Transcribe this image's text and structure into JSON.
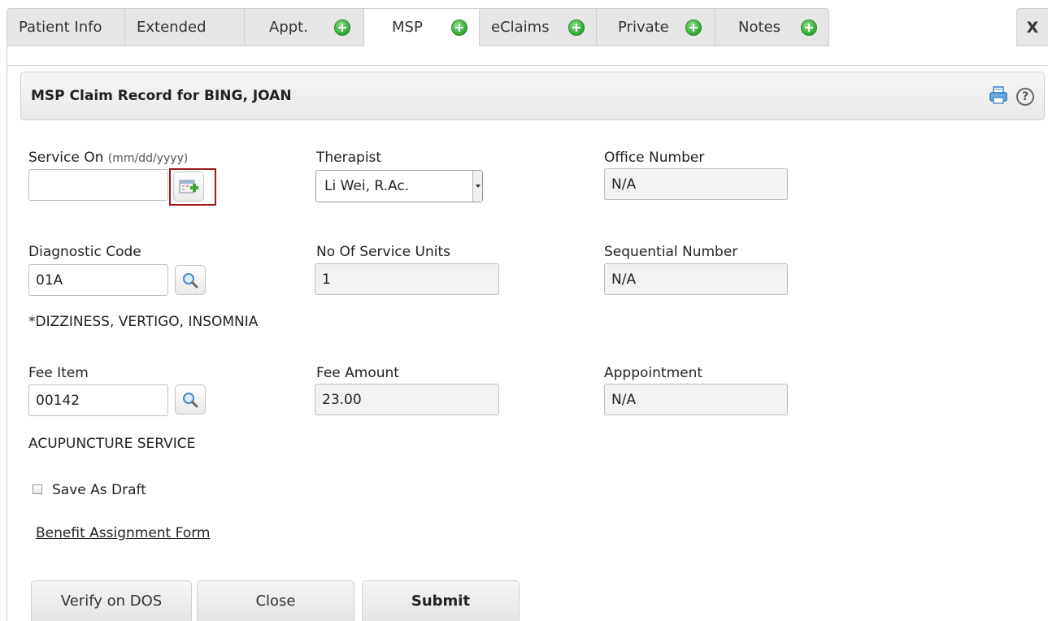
{
  "tabs": [
    {
      "label": "Patient Info",
      "has_add": false
    },
    {
      "label": "Extended",
      "has_add": false
    },
    {
      "label": "Appt.",
      "has_add": true
    },
    {
      "label": "MSP",
      "has_add": true,
      "active": true
    },
    {
      "label": "eClaims",
      "has_add": true
    },
    {
      "label": "Private",
      "has_add": true
    },
    {
      "label": "Notes",
      "has_add": true
    }
  ],
  "close_label": "X",
  "panel": {
    "title": "MSP Claim Record for BING, JOAN",
    "icons": [
      "print-icon",
      "help-icon"
    ]
  },
  "form": {
    "service_on": {
      "label": "Service On",
      "hint": "(mm/dd/yyyy)",
      "value": ""
    },
    "therapist": {
      "label": "Therapist",
      "value": "Li Wei, R.Ac."
    },
    "office_number": {
      "label": "Office Number",
      "value": "N/A"
    },
    "diagnostic_code": {
      "label": "Diagnostic Code",
      "value": "01A",
      "description": "*DIZZINESS, VERTIGO, INSOMNIA"
    },
    "service_units": {
      "label": "No Of Service Units",
      "value": "1"
    },
    "sequential_number": {
      "label": "Sequential Number",
      "value": "N/A"
    },
    "fee_item": {
      "label": "Fee Item",
      "value": "00142",
      "description": "ACUPUNCTURE SERVICE"
    },
    "fee_amount": {
      "label": "Fee Amount",
      "value": "23.00"
    },
    "appointment": {
      "label": "Apppointment",
      "value": "N/A"
    },
    "save_as_draft": {
      "label": "Save As Draft",
      "checked": false
    },
    "benefit_link": "Benefit Assignment Form"
  },
  "buttons": {
    "verify": "Verify on DOS",
    "close": "Close",
    "submit": "Submit"
  },
  "colors": {
    "accent_green": "#2fa52f",
    "highlight_red": "#9b1a1a"
  }
}
